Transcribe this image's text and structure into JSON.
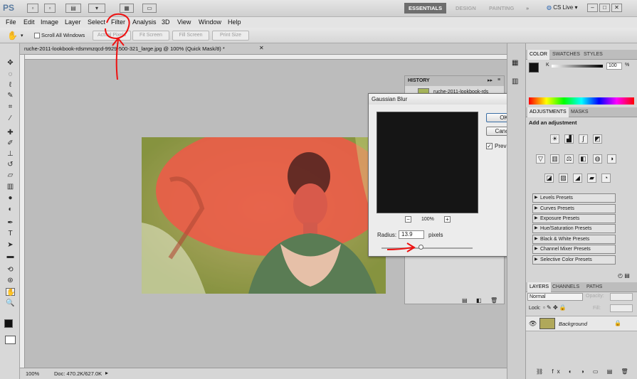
{
  "app": {
    "logo": "PS",
    "title": "CS Live"
  },
  "workspaces": [
    "ESSENTIALS",
    "DESIGN",
    "PAINTING"
  ],
  "menu": [
    "File",
    "Edit",
    "Image",
    "Layer",
    "Select",
    "Filter",
    "Analysis",
    "3D",
    "View",
    "Window",
    "Help"
  ],
  "options": {
    "scroll_all_label": "Scroll All Windows",
    "buttons": [
      "Actual Pixels",
      "Fit Screen",
      "Fill Screen",
      "Print Size"
    ]
  },
  "document": {
    "tab_title": "ruche-2011-lookbook-rdsmmzqcd-9929-500-321_large.jpg @ 100% (Quick Mask/8) *"
  },
  "status": {
    "zoom": "100%",
    "doc_info": "Doc: 470.2K/627.0K"
  },
  "history": {
    "tab": "HISTORY",
    "item": "ruche-2011-lookbook-rds"
  },
  "dialog": {
    "title": "Gaussian Blur",
    "ok": "OK",
    "cancel": "Cancel",
    "preview_label": "Preview",
    "zoom": "100%",
    "radius_label": "Radius:",
    "radius_value": "13.9",
    "unit": "pixels"
  },
  "color_panel": {
    "tabs": [
      "COLOR",
      "SWATCHES",
      "STYLES"
    ],
    "channel": "K",
    "value": "100",
    "unit": "%"
  },
  "adjustments": {
    "tabs": [
      "ADJUSTMENTS",
      "MASKS"
    ],
    "heading": "Add an adjustment",
    "presets": [
      "Levels Presets",
      "Curves Presets",
      "Exposure Presets",
      "Hue/Saturation Presets",
      "Black & White Presets",
      "Channel Mixer Presets",
      "Selective Color Presets"
    ]
  },
  "layers": {
    "tabs": [
      "LAYERS",
      "CHANNELS",
      "PATHS"
    ],
    "blend_mode": "Normal",
    "opacity_label": "Opacity:",
    "lock_label": "Lock:",
    "fill_label": "Fill:",
    "layer_name": "Background"
  }
}
